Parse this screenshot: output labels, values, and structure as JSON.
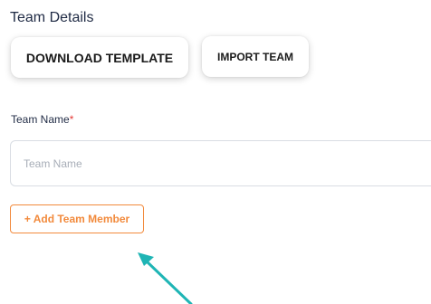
{
  "section": {
    "title": "Team Details"
  },
  "actions": {
    "download_label": "DOWNLOAD TEMPLATE",
    "import_label": "IMPORT TEAM"
  },
  "team_name": {
    "label": "Team Name",
    "required_mark": "*",
    "placeholder": "Team Name",
    "value": ""
  },
  "add_member": {
    "label": "+ Add Team Member"
  },
  "colors": {
    "accent": "#f28a3c",
    "required": "#e53935",
    "annotation_arrow": "#1fb5b5"
  },
  "annotation": {
    "icon": "pointer-arrow-icon"
  }
}
